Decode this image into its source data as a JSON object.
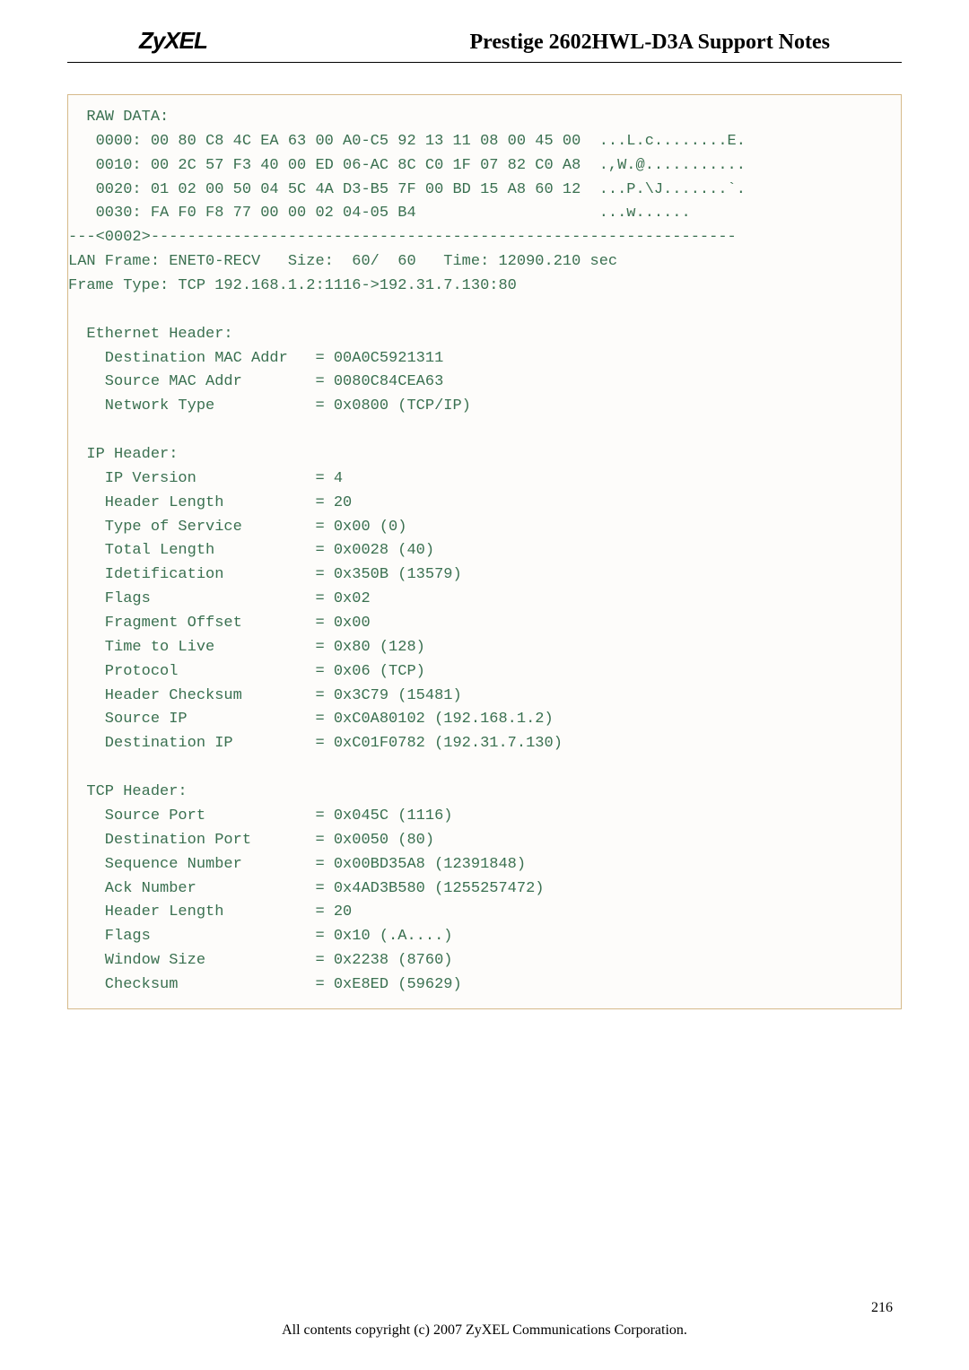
{
  "header": {
    "logo": "ZyXEL",
    "title": "Prestige 2602HWL-D3A Support Notes"
  },
  "code": {
    "lines": [
      "  RAW DATA:",
      "   0000: 00 80 C8 4C EA 63 00 A0-C5 92 13 11 08 00 45 00  ...L.c........E.",
      "   0010: 00 2C 57 F3 40 00 ED 06-AC 8C C0 1F 07 82 C0 A8  .,W.@...........",
      "   0020: 01 02 00 50 04 5C 4A D3-B5 7F 00 BD 15 A8 60 12  ...P.\\J.......`.",
      "   0030: FA F0 F8 77 00 00 02 04-05 B4                    ...w......",
      "---<0002>----------------------------------------------------------------",
      "LAN Frame: ENET0-RECV   Size:  60/  60   Time: 12090.210 sec",
      "Frame Type: TCP 192.168.1.2:1116->192.31.7.130:80",
      "",
      "  Ethernet Header:",
      "    Destination MAC Addr   = 00A0C5921311",
      "    Source MAC Addr        = 0080C84CEA63",
      "    Network Type           = 0x0800 (TCP/IP)",
      "",
      "  IP Header:",
      "    IP Version             = 4",
      "    Header Length          = 20",
      "    Type of Service        = 0x00 (0)",
      "    Total Length           = 0x0028 (40)",
      "    Idetification          = 0x350B (13579)",
      "    Flags                  = 0x02",
      "    Fragment Offset        = 0x00",
      "    Time to Live           = 0x80 (128)",
      "    Protocol               = 0x06 (TCP)",
      "    Header Checksum        = 0x3C79 (15481)",
      "    Source IP              = 0xC0A80102 (192.168.1.2)",
      "    Destination IP         = 0xC01F0782 (192.31.7.130)",
      "",
      "  TCP Header:",
      "    Source Port            = 0x045C (1116)",
      "    Destination Port       = 0x0050 (80)",
      "    Sequence Number        = 0x00BD35A8 (12391848)",
      "    Ack Number             = 0x4AD3B580 (1255257472)",
      "    Header Length          = 20",
      "    Flags                  = 0x10 (.A....)",
      "    Window Size            = 0x2238 (8760)",
      "    Checksum               = 0xE8ED (59629)"
    ]
  },
  "footer": {
    "page": "216",
    "copyright": "All contents copyright (c) 2007 ZyXEL Communications Corporation."
  }
}
